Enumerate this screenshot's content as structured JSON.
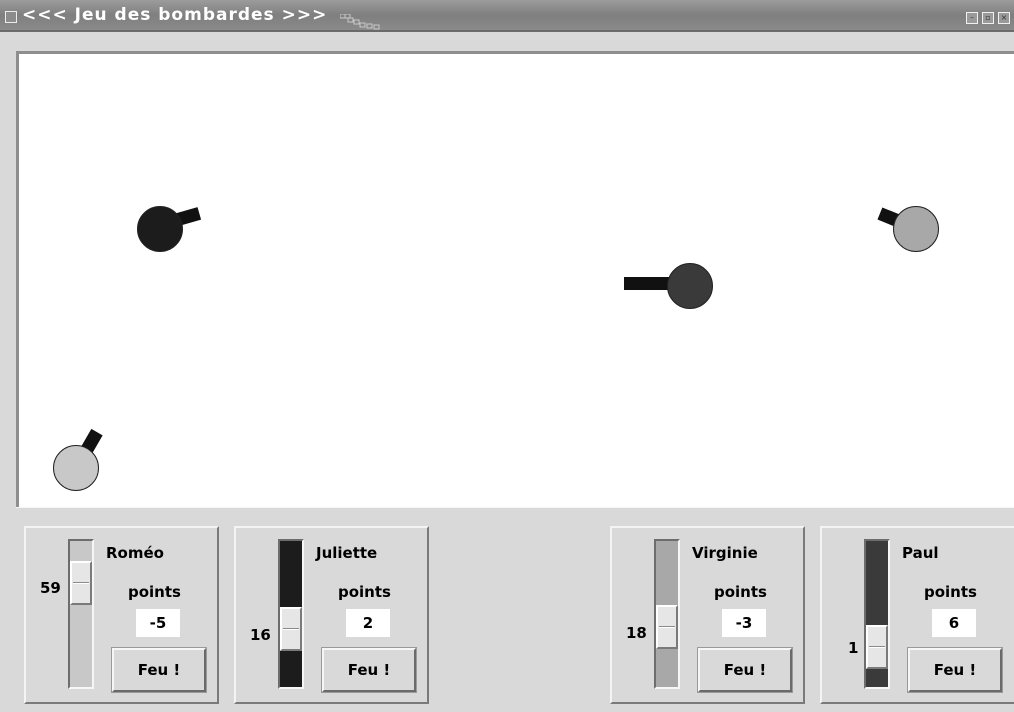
{
  "window": {
    "title": "<<< Jeu des bombardes >>>",
    "menu_icon": "window-menu-icon",
    "controls": [
      "minimize-icon",
      "maximize-icon",
      "close-icon"
    ]
  },
  "colors": {
    "canvas_bg": "#ffffff",
    "panel_bg": "#d9d9d9",
    "romeo": "#c8c8c8",
    "juliette": "#1c1c1c",
    "virginie": "#a8a8a8",
    "paul": "#3a3a3a"
  },
  "players": [
    {
      "name": "Roméo",
      "points_label": "points",
      "score": "-5",
      "angle": "59",
      "fire_label": "Feu !"
    },
    {
      "name": "Juliette",
      "points_label": "points",
      "score": "2",
      "angle": "16",
      "fire_label": "Feu !"
    },
    {
      "name": "Virginie",
      "points_label": "points",
      "score": "-3",
      "angle": "18",
      "fire_label": "Feu !"
    },
    {
      "name": "Paul",
      "points_label": "points",
      "score": "6",
      "angle": "1",
      "fire_label": "Feu !"
    }
  ]
}
